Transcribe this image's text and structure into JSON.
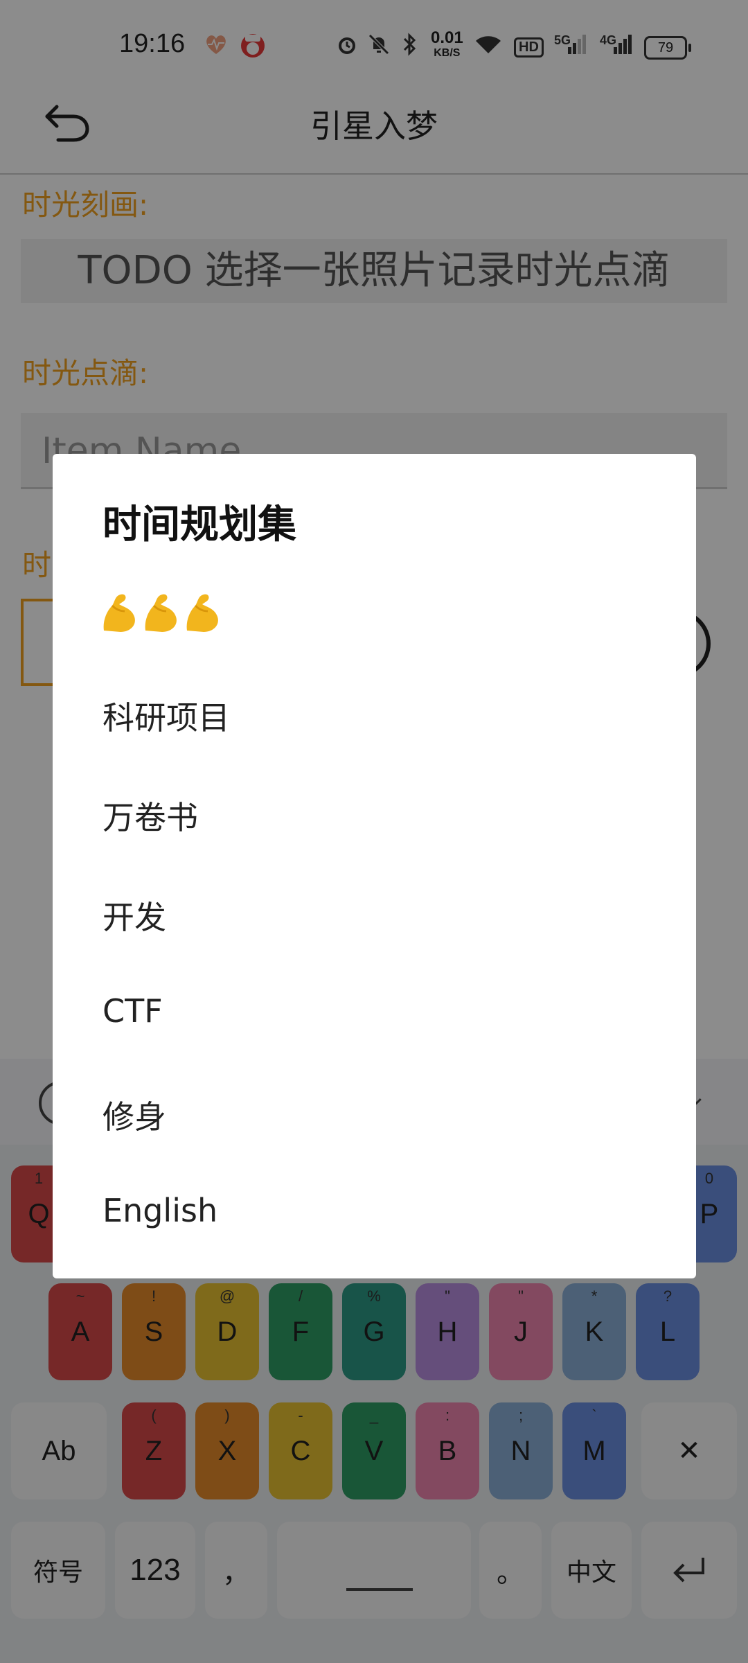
{
  "status_bar": {
    "time": "19:16",
    "speed_value": "0.01",
    "speed_unit": "KB/S",
    "hd_label": "HD",
    "net1": "5G",
    "net2": "4G",
    "battery": "79"
  },
  "app_bar": {
    "title": "引星入梦"
  },
  "form": {
    "label1": "时光刻画:",
    "photo_prompt": "TODO 选择一张照片记录时光点滴",
    "label2": "时光点滴:",
    "item_name_placeholder": "Item Name",
    "label3_fragment": "时"
  },
  "dialog": {
    "title": "时间规划集",
    "items": [
      {
        "label": "💪💪💪"
      },
      {
        "label": "科研项目"
      },
      {
        "label": "万卷书"
      },
      {
        "label": "开发"
      },
      {
        "label": "CTF"
      },
      {
        "label": "修身"
      },
      {
        "label": "English"
      }
    ]
  },
  "keyboard": {
    "row2": [
      {
        "k": "A",
        "s": "~",
        "c": "#d84a4a"
      },
      {
        "k": "S",
        "s": "!",
        "c": "#e58a2a"
      },
      {
        "k": "D",
        "s": "@",
        "c": "#e8c232"
      },
      {
        "k": "F",
        "s": "/",
        "c": "#2e9d64"
      },
      {
        "k": "G",
        "s": "%",
        "c": "#2d9a86"
      },
      {
        "k": "H",
        "s": "\"",
        "c": "#b88fe0"
      },
      {
        "k": "J",
        "s": "\"",
        "c": "#ef86b0"
      },
      {
        "k": "K",
        "s": "*",
        "c": "#8ab0d8"
      },
      {
        "k": "L",
        "s": "?",
        "c": "#6b8ee0"
      }
    ],
    "row3": [
      {
        "k": "Z",
        "s": "(",
        "c": "#d84a4a"
      },
      {
        "k": "X",
        "s": ")",
        "c": "#e58a2a"
      },
      {
        "k": "C",
        "s": "-",
        "c": "#e8c232"
      },
      {
        "k": "V",
        "s": "_",
        "c": "#2e9d64"
      },
      {
        "k": "B",
        "s": ":",
        "c": "#ef86b0"
      },
      {
        "k": "N",
        "s": ";",
        "c": "#8ab0d8"
      },
      {
        "k": "M",
        "s": "`",
        "c": "#6b8ee0"
      }
    ],
    "row1_left": {
      "k": "Q",
      "s": "1"
    },
    "row1_right": {
      "k": "P",
      "s": "0"
    },
    "shift": "Ab",
    "delete": "✕",
    "symbols": "符号",
    "num": "123",
    "comma": "，",
    "period": "。",
    "lang": "中文"
  }
}
